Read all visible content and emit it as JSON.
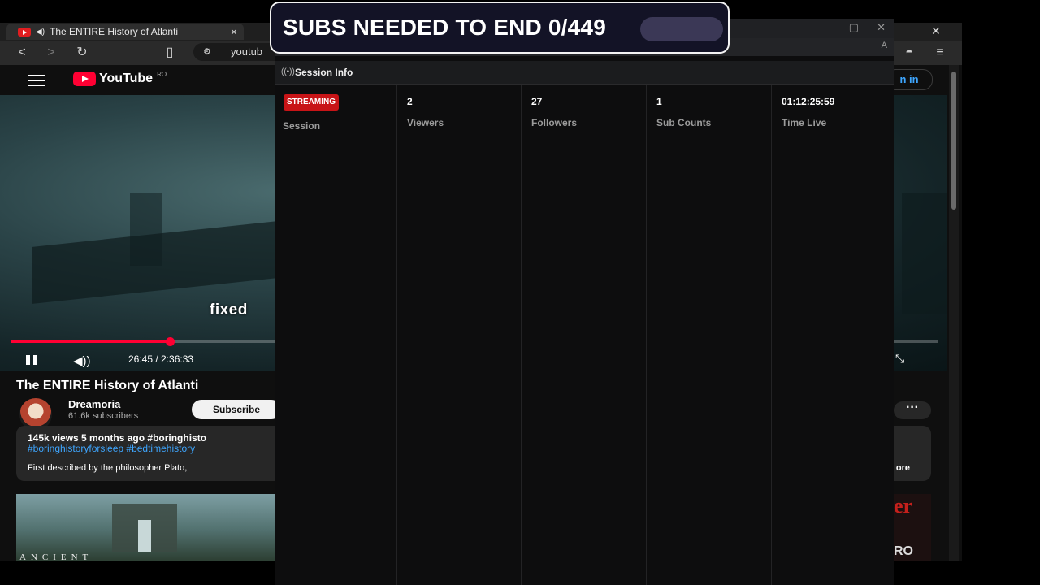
{
  "browser": {
    "tab_title": "The ENTIRE History of Atlanti",
    "tab_close": "×",
    "window_close": "✕",
    "url": "youtub"
  },
  "youtube": {
    "logo_text": "YouTube",
    "region": "RO",
    "signin_label": "n in",
    "subtitle": "fixed",
    "player": {
      "timecode": "26:45 / 2:36:33",
      "progress_fraction": 0.171
    },
    "video_title": "The ENTIRE History of Atlanti",
    "channel": {
      "name": "Dreamoria",
      "subscribers": "61.6k subscribers",
      "subscribe_label": "Subscribe"
    },
    "more_label": "···",
    "description": {
      "meta": "145k views  5 months ago  #boringhisto",
      "tags": "#boringhistoryforsleep #bedtimehistory",
      "text": "First described by the philosopher Plato,",
      "more": "ore"
    },
    "thumb1_text": "ANCIENT",
    "thumb2_text": "er",
    "thumb2_text2": "RO"
  },
  "session": {
    "title": "Session Info",
    "status_badge": "STREAMING",
    "session_label": "Session",
    "stats": [
      {
        "value": "2",
        "label": "Viewers"
      },
      {
        "value": "27",
        "label": "Followers"
      },
      {
        "value": "1",
        "label": "Sub Counts"
      },
      {
        "value": "01:12:25:59",
        "label": "Time Live"
      }
    ]
  },
  "banner": {
    "text": "SUBS NEEDED TO END 0/449",
    "progress_fraction": 0
  }
}
